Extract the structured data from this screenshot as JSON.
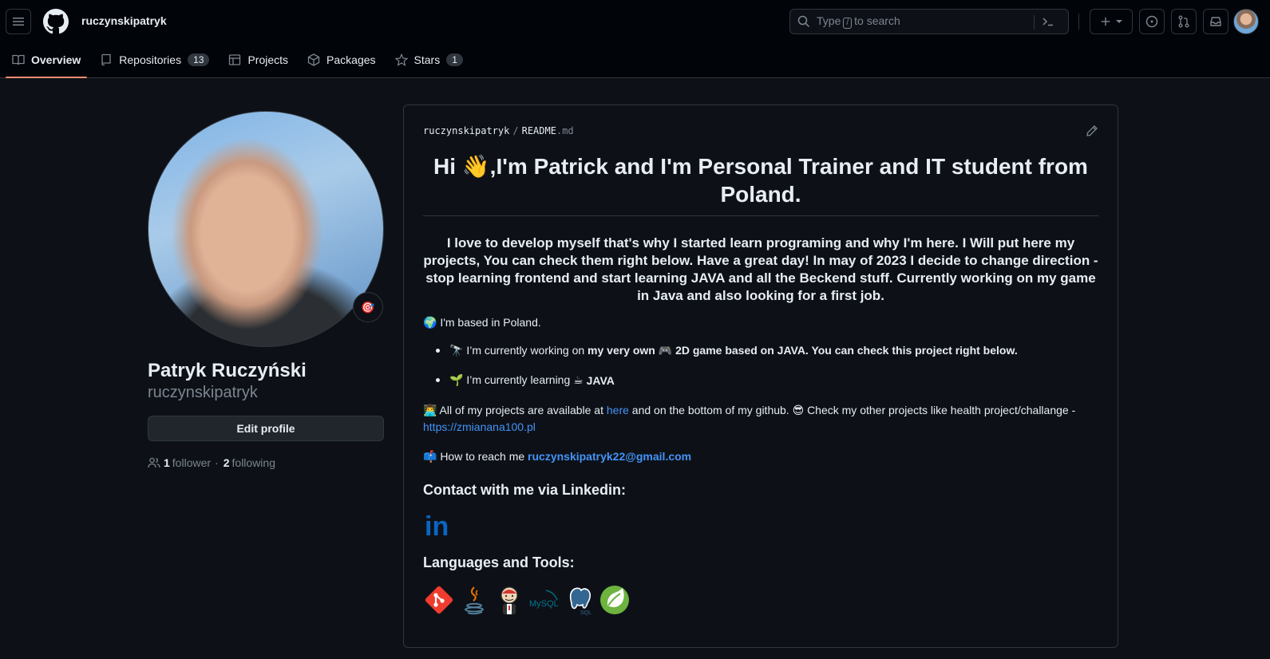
{
  "header": {
    "owner": "ruczynskipatryk",
    "search": {
      "prefix": "Type",
      "key": "/",
      "suffix": "to search"
    }
  },
  "tabs": [
    {
      "label": "Overview",
      "active": true
    },
    {
      "label": "Repositories",
      "count": "13"
    },
    {
      "label": "Projects"
    },
    {
      "label": "Packages"
    },
    {
      "label": "Stars",
      "count": "1"
    }
  ],
  "profile": {
    "full_name": "Patryk Ruczyński",
    "login": "ruczynskipatryk",
    "edit_label": "Edit profile",
    "followers": "1",
    "followers_label": "follower",
    "separator": "·",
    "following": "2",
    "following_label": "following",
    "status_emoji": "🎯"
  },
  "readme": {
    "path_owner": "ruczynskipatryk",
    "path_sep": "/",
    "path_file": "README",
    "path_ext": ".md",
    "title": "Hi 👋,I'm Patrick and I'm Personal Trainer and IT student from Poland.",
    "intro": "I love to develop myself that's why I started learn programing and why I'm here. I Will put here my projects, You can check them right below. Have a great day! In may of 2023 I decide to change direction - stop learning frontend and start learning JAVA and all the Beckend stuff. Currently working on my game in Java and also looking for a first job.",
    "based": "🌍 I'm based in Poland.",
    "working_prefix": "🔭 I’m currently working on",
    "working_bold": "my very own 🎮 2D game based on JAVA. You can check this project right below.",
    "learning_prefix": "🌱 I’m currently learning ☕",
    "learning_bold": "JAVA",
    "projects_prefix": "👨‍💻 All of my projects are available at",
    "projects_link": "here",
    "projects_middle": "and on the bottom of my github. 😎 Check my other projects like health project/challange -",
    "projects_url": "https://zmianana100.pl",
    "reach_prefix": "📫 How to reach me",
    "reach_email": "ruczynskipatryk22@gmail.com",
    "contact_heading": "Contact with me via Linkedin:",
    "linkedin_text": "in",
    "tools_heading": "Languages and Tools:",
    "tools": [
      {
        "name": "git",
        "color": "#f03c2e"
      },
      {
        "name": "java",
        "color": "#5382a1"
      },
      {
        "name": "jenkins",
        "color": "#d33833"
      },
      {
        "name": "mysql",
        "label": "MySQL",
        "color": "#00758f"
      },
      {
        "name": "postgresql",
        "label": "SQL",
        "color": "#336791"
      },
      {
        "name": "spring",
        "color": "#6db33f"
      }
    ]
  }
}
